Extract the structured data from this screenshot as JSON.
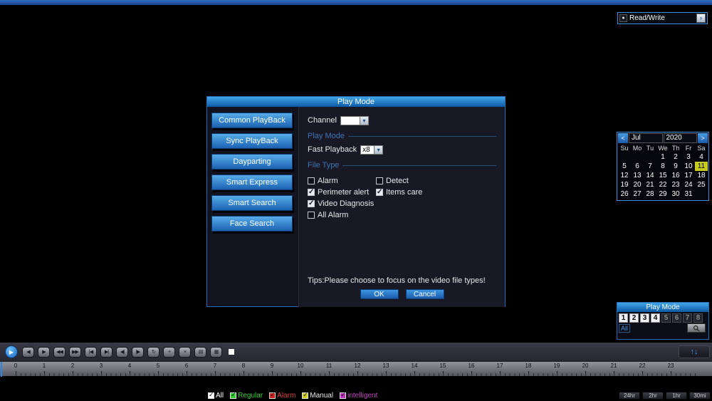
{
  "top_bar": {
    "read_write": {
      "label": "Read/Write"
    }
  },
  "icons": {
    "dropdown_arrow": "▾",
    "rw_arrow": "›",
    "record_dot": "●",
    "play": "▶",
    "scroll_arrows": "↑↓"
  },
  "calendar": {
    "prev_label": "<",
    "next_label": ">",
    "month": "Jul",
    "year": "2020",
    "selected_day": "11",
    "weekdays": [
      "Su",
      "Mo",
      "Tu",
      "We",
      "Th",
      "Fr",
      "Sa"
    ],
    "days": [
      {
        "n": "1"
      },
      {
        "n": "2"
      },
      {
        "n": "3"
      },
      {
        "n": "4"
      },
      {
        "n": "5"
      },
      {
        "n": "6"
      },
      {
        "n": "7"
      },
      {
        "n": "8"
      },
      {
        "n": "9"
      },
      {
        "n": "10"
      },
      {
        "n": "11",
        "sel": true
      },
      {
        "n": "12"
      },
      {
        "n": "13"
      },
      {
        "n": "14"
      },
      {
        "n": "15"
      },
      {
        "n": "16"
      },
      {
        "n": "17"
      },
      {
        "n": "18"
      },
      {
        "n": "19"
      },
      {
        "n": "20"
      },
      {
        "n": "21"
      },
      {
        "n": "22"
      },
      {
        "n": "23"
      },
      {
        "n": "24"
      },
      {
        "n": "25"
      },
      {
        "n": "26"
      },
      {
        "n": "27"
      },
      {
        "n": "28"
      },
      {
        "n": "29"
      },
      {
        "n": "30"
      },
      {
        "n": "31"
      }
    ]
  },
  "dialog": {
    "title": "Play Mode",
    "sidebar": [
      {
        "label": "Common PlayBack",
        "name": "common-playback-button"
      },
      {
        "label": "Sync PlayBack",
        "name": "sync-playback-button"
      },
      {
        "label": "Dayparting",
        "name": "dayparting-button"
      },
      {
        "label": "Smart Express",
        "name": "smart-express-button"
      },
      {
        "label": "Smart Search",
        "name": "smart-search-button"
      },
      {
        "label": "Face Search",
        "name": "face-search-button"
      }
    ],
    "channel_label": "Channel",
    "channel_value": "",
    "play_mode_section": "Play Mode",
    "fast_playback_label": "Fast Playback",
    "fast_playback_value": "x8",
    "file_type_section": "File Type",
    "file_types": [
      {
        "label": "Alarm",
        "checked": false
      },
      {
        "label": "Detect",
        "checked": false
      },
      {
        "label": "Perimeter alert",
        "checked": true
      },
      {
        "label": "Items care",
        "checked": true
      },
      {
        "label": "Video Diagnosis",
        "checked": true
      },
      {
        "label": "All Alarm",
        "checked": false
      }
    ],
    "tips": "Tips:Please choose to focus on the video file types!",
    "ok_label": "OK",
    "cancel_label": "Cancel"
  },
  "channel_panel": {
    "title": "Play Mode",
    "all_label": "All",
    "channels": [
      {
        "n": "1",
        "active": true
      },
      {
        "n": "2",
        "active": true
      },
      {
        "n": "3",
        "active": true
      },
      {
        "n": "4",
        "active": true
      },
      {
        "n": "5",
        "active": false
      },
      {
        "n": "6",
        "active": false
      },
      {
        "n": "7",
        "active": false
      },
      {
        "n": "8",
        "active": false
      }
    ]
  },
  "playbar": {
    "buttons": [
      {
        "glyph": "◀",
        "name": "reverse-play-button"
      },
      {
        "glyph": "▶",
        "name": "slow-play-button"
      },
      {
        "glyph": "◀◀",
        "name": "fast-rewind-button"
      },
      {
        "glyph": "▶▶",
        "name": "fast-forward-button"
      },
      {
        "glyph": "|◀",
        "name": "previous-file-button"
      },
      {
        "glyph": "▶|",
        "name": "next-file-button"
      },
      {
        "glyph": "◀|",
        "name": "previous-frame-button"
      },
      {
        "glyph": "|▶",
        "name": "next-frame-button"
      },
      {
        "glyph": "↻",
        "name": "repeat-button"
      },
      {
        "glyph": "+",
        "name": "clip-button"
      },
      {
        "glyph": "×",
        "name": "close-button"
      },
      {
        "glyph": "▤",
        "name": "file-list-button"
      },
      {
        "glyph": "▦",
        "name": "split-view-button"
      }
    ]
  },
  "timeline": {
    "hours": [
      "0",
      "1",
      "2",
      "3",
      "4",
      "5",
      "6",
      "7",
      "8",
      "9",
      "10",
      "11",
      "12",
      "13",
      "14",
      "15",
      "16",
      "17",
      "18",
      "19",
      "20",
      "21",
      "22",
      "23"
    ]
  },
  "legend": {
    "items": [
      {
        "label": "All",
        "color": "#ffffff",
        "label_color": "#ffffff"
      },
      {
        "label": "Regular",
        "color": "#33cc33",
        "label_color": "#33cc33"
      },
      {
        "label": "Alarm",
        "color": "#cc2222",
        "label_color": "#dd4444"
      },
      {
        "label": "Manual",
        "color": "#cccc22",
        "label_color": "#e8e8e8"
      },
      {
        "label": "intelligent",
        "color": "#bb33bb",
        "label_color": "#bb44bb"
      }
    ]
  },
  "scale_buttons": [
    {
      "label": "24hr",
      "name": "scale-24hr-button"
    },
    {
      "label": "2hr",
      "name": "scale-2hr-button"
    },
    {
      "label": "1hr",
      "name": "scale-1hr-button"
    },
    {
      "label": "30mi",
      "name": "scale-30min-button"
    }
  ]
}
